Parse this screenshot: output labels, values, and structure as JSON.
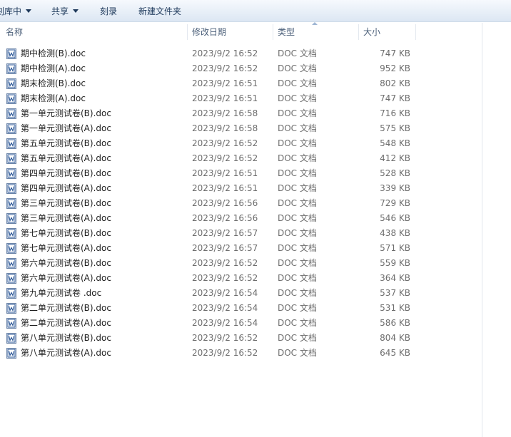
{
  "toolbar": {
    "items": [
      {
        "label": "刻库中",
        "dropdown": true
      },
      {
        "label": "共享",
        "dropdown": true
      },
      {
        "label": "刻录",
        "dropdown": false
      },
      {
        "label": "新建文件夹",
        "dropdown": false
      }
    ]
  },
  "columns": {
    "name": "名称",
    "date": "修改日期",
    "type": "类型",
    "size": "大小"
  },
  "icon": "word-doc-icon",
  "colors": {
    "icon_blue": "#2b5797",
    "header_text": "#4c607a",
    "toolbar_text": "#1e395b"
  },
  "files": [
    {
      "name": "期中检测(B).doc",
      "date": "2023/9/2 16:52",
      "type": "DOC 文档",
      "size": "747 KB"
    },
    {
      "name": "期中检测(A).doc",
      "date": "2023/9/2 16:52",
      "type": "DOC 文档",
      "size": "952 KB"
    },
    {
      "name": "期末检测(B).doc",
      "date": "2023/9/2 16:51",
      "type": "DOC 文档",
      "size": "802 KB"
    },
    {
      "name": "期末检测(A).doc",
      "date": "2023/9/2 16:51",
      "type": "DOC 文档",
      "size": "747 KB"
    },
    {
      "name": "第一单元测试卷(B).doc",
      "date": "2023/9/2 16:58",
      "type": "DOC 文档",
      "size": "716 KB"
    },
    {
      "name": "第一单元测试卷(A).doc",
      "date": "2023/9/2 16:58",
      "type": "DOC 文档",
      "size": "575 KB"
    },
    {
      "name": "第五单元测试卷(B).doc",
      "date": "2023/9/2 16:52",
      "type": "DOC 文档",
      "size": "548 KB"
    },
    {
      "name": "第五单元测试卷(A).doc",
      "date": "2023/9/2 16:52",
      "type": "DOC 文档",
      "size": "412 KB"
    },
    {
      "name": "第四单元测试卷(B).doc",
      "date": "2023/9/2 16:51",
      "type": "DOC 文档",
      "size": "528 KB"
    },
    {
      "name": "第四单元测试卷(A).doc",
      "date": "2023/9/2 16:51",
      "type": "DOC 文档",
      "size": "339 KB"
    },
    {
      "name": "第三单元测试卷(B).doc",
      "date": "2023/9/2 16:56",
      "type": "DOC 文档",
      "size": "729 KB"
    },
    {
      "name": "第三单元测试卷(A).doc",
      "date": "2023/9/2 16:56",
      "type": "DOC 文档",
      "size": "546 KB"
    },
    {
      "name": "第七单元测试卷(B).doc",
      "date": "2023/9/2 16:57",
      "type": "DOC 文档",
      "size": "438 KB"
    },
    {
      "name": "第七单元测试卷(A).doc",
      "date": "2023/9/2 16:57",
      "type": "DOC 文档",
      "size": "571 KB"
    },
    {
      "name": "第六单元测试卷(B).doc",
      "date": "2023/9/2 16:52",
      "type": "DOC 文档",
      "size": "559 KB"
    },
    {
      "name": "第六单元测试卷(A).doc",
      "date": "2023/9/2 16:52",
      "type": "DOC 文档",
      "size": "364 KB"
    },
    {
      "name": "第九单元测试卷 .doc",
      "date": "2023/9/2 16:54",
      "type": "DOC 文档",
      "size": "537 KB"
    },
    {
      "name": "第二单元测试卷(B).doc",
      "date": "2023/9/2 16:54",
      "type": "DOC 文档",
      "size": "531 KB"
    },
    {
      "name": "第二单元测试卷(A).doc",
      "date": "2023/9/2 16:54",
      "type": "DOC 文档",
      "size": "586 KB"
    },
    {
      "name": "第八单元测试卷(B).doc",
      "date": "2023/9/2 16:52",
      "type": "DOC 文档",
      "size": "804 KB"
    },
    {
      "name": "第八单元测试卷(A).doc",
      "date": "2023/9/2 16:52",
      "type": "DOC 文档",
      "size": "645 KB"
    }
  ]
}
